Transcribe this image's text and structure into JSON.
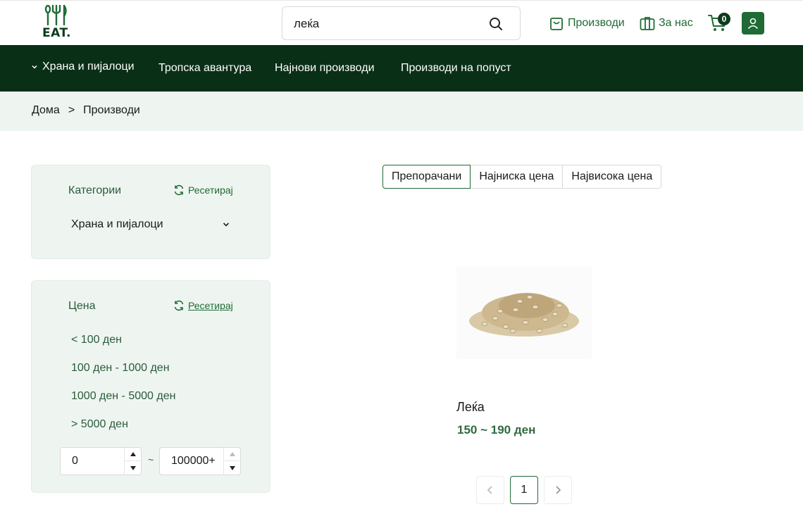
{
  "header": {
    "logo_text": "EAT.",
    "search": {
      "value": "леќа"
    },
    "nav": [
      {
        "label": "Производи",
        "icon": "shopping-bag-icon"
      },
      {
        "label": "За нас",
        "icon": "building-icon"
      }
    ],
    "cart": {
      "count": "0",
      "icon": "cart-icon"
    },
    "user_icon": "user-icon",
    "accent_color": "#1e6b35"
  },
  "categories_bar": {
    "background": "#0a2f17",
    "items": [
      {
        "label": "Храна и пијалоци",
        "has_chevron": true
      },
      {
        "label": "Тропска авантура"
      },
      {
        "label": "Најнови производи"
      },
      {
        "label": "Производи на попуст"
      }
    ]
  },
  "breadcrumb": {
    "items": [
      "Дома",
      "Производи"
    ],
    "separator": ">"
  },
  "filters": {
    "category_panel": {
      "title": "Категории",
      "reset_label": "Ресетирај",
      "selected": "Храна и пијалоци"
    },
    "price_panel": {
      "title": "Цена",
      "reset_label": "Ресетирај",
      "options": [
        "< 100 ден",
        "100 ден - 1000 ден",
        "1000 ден - 5000 ден",
        "> 5000 ден"
      ],
      "min_value": "0",
      "max_value": "100000+",
      "range_separator": "~"
    }
  },
  "sort": {
    "tabs": [
      "Препорачани",
      "Најниска цена",
      "Највисока цена"
    ],
    "active_index": 0
  },
  "products": [
    {
      "name": "Леќа",
      "price": "150 ~ 190 ден"
    }
  ],
  "pagination": {
    "current_page": "1"
  }
}
